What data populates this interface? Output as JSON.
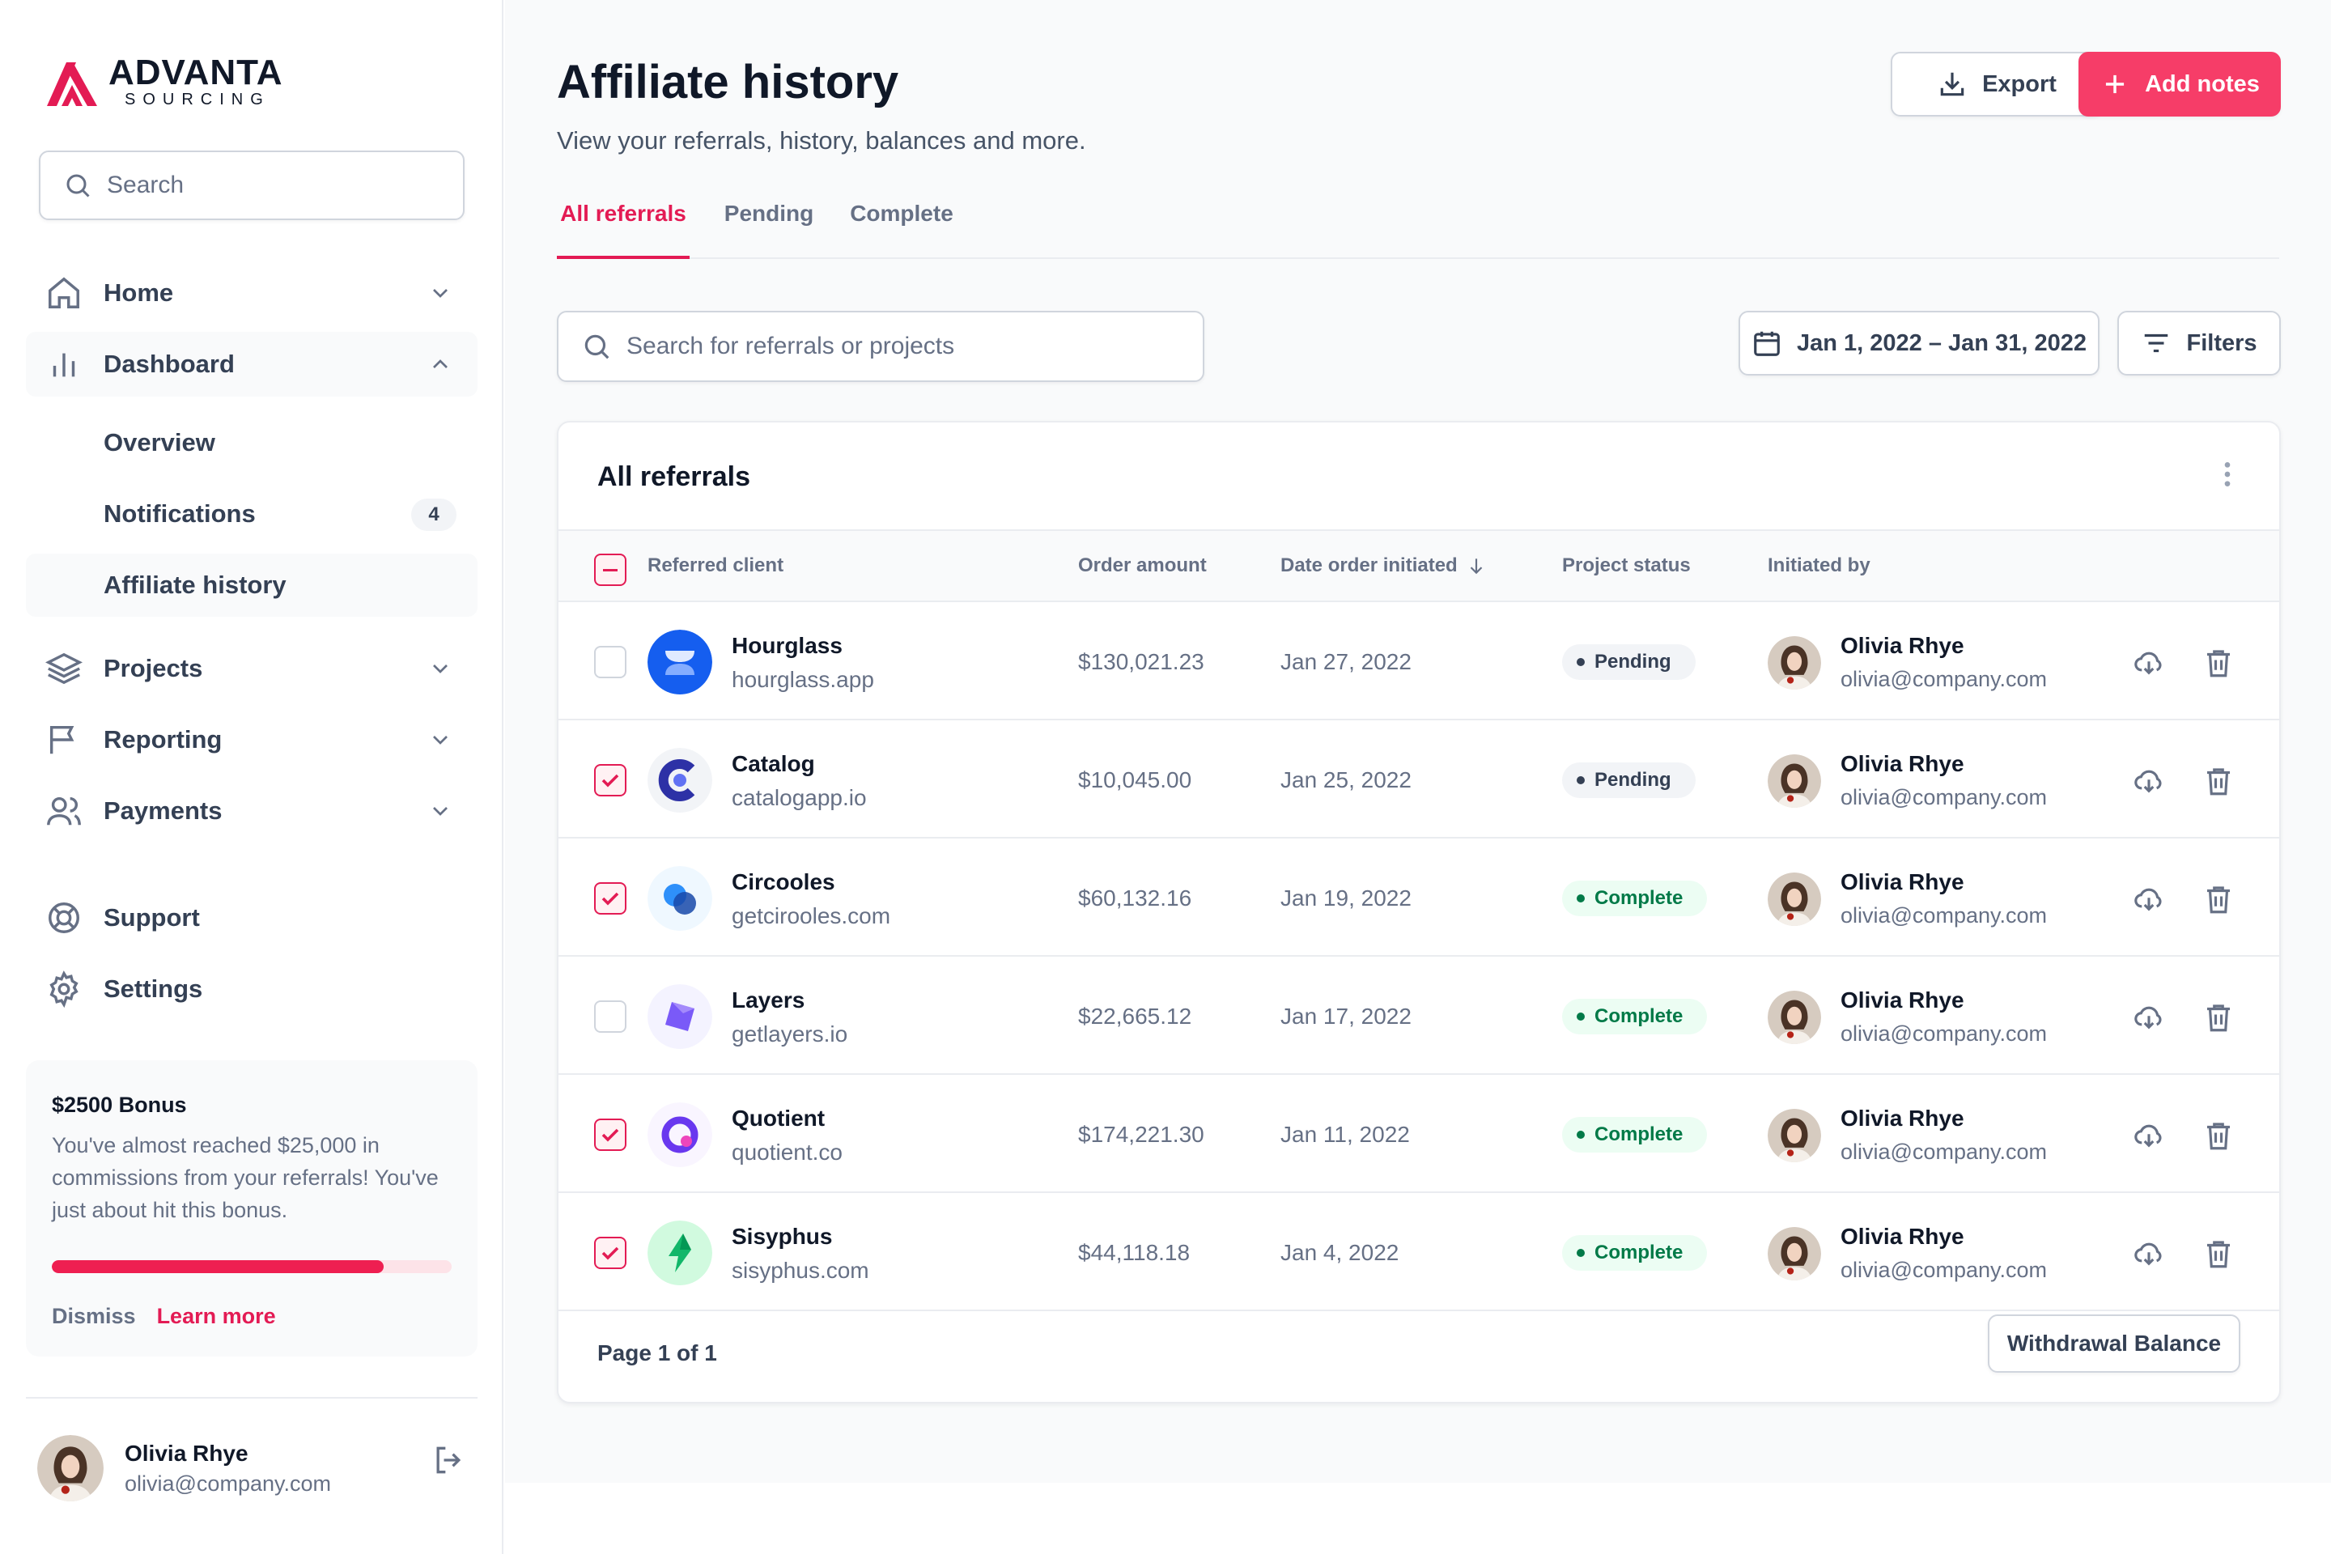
{
  "brand": {
    "name": "ADVANTA",
    "sub": "SOURCING",
    "accent": "#e31b54"
  },
  "sidebar": {
    "search_placeholder": "Search",
    "nav": [
      {
        "label": "Home",
        "icon": "home-icon"
      },
      {
        "label": "Dashboard",
        "icon": "bar-chart-icon"
      },
      {
        "label": "Projects",
        "icon": "layers-icon"
      },
      {
        "label": "Reporting",
        "icon": "flag-icon"
      },
      {
        "label": "Payments",
        "icon": "users-icon"
      },
      {
        "label": "Support",
        "icon": "life-buoy-icon"
      },
      {
        "label": "Settings",
        "icon": "gear-icon"
      }
    ],
    "sub_items": [
      {
        "label": "Overview"
      },
      {
        "label": "Notifications",
        "count": "4"
      },
      {
        "label": "Affiliate history"
      }
    ],
    "bonus": {
      "title": "$2500 Bonus",
      "text": "You've almost reached $25,000 in commissions from your referrals! You've just about hit this bonus.",
      "progress": 0.83,
      "dismiss": "Dismiss",
      "learn_more": "Learn more"
    },
    "user": {
      "name": "Olivia Rhye",
      "email": "olivia@company.com"
    }
  },
  "header": {
    "title": "Affiliate history",
    "subtitle": "View your referrals, history, balances and more.",
    "export_label": "Export",
    "add_label": "Add notes"
  },
  "tabs": [
    {
      "label": "All referrals",
      "active": true
    },
    {
      "label": "Pending",
      "active": false
    },
    {
      "label": "Complete",
      "active": false
    }
  ],
  "toolbar": {
    "search_placeholder": "Search for referrals or projects",
    "date_range": "Jan 1, 2022 – Jan 31, 2022",
    "filters_label": "Filters"
  },
  "table": {
    "title": "All referrals",
    "columns": [
      "Referred client",
      "Order amount",
      "Date order initiated",
      "Project status",
      "Initiated by"
    ],
    "rows": [
      {
        "client": "Hourglass",
        "url": "hourglass.app",
        "amount": "$130,021.23",
        "date": "Jan 27, 2022",
        "status": "Pending",
        "checked": false,
        "by_name": "Olivia Rhye",
        "by_email": "olivia@company.com"
      },
      {
        "client": "Catalog",
        "url": "catalogapp.io",
        "amount": "$10,045.00",
        "date": "Jan 25, 2022",
        "status": "Pending",
        "checked": true,
        "by_name": "Olivia Rhye",
        "by_email": "olivia@company.com"
      },
      {
        "client": "Circooles",
        "url": "getcirooles.com",
        "amount": "$60,132.16",
        "date": "Jan 19, 2022",
        "status": "Complete",
        "checked": true,
        "by_name": "Olivia Rhye",
        "by_email": "olivia@company.com"
      },
      {
        "client": "Layers",
        "url": "getlayers.io",
        "amount": "$22,665.12",
        "date": "Jan 17, 2022",
        "status": "Complete",
        "checked": false,
        "by_name": "Olivia Rhye",
        "by_email": "olivia@company.com"
      },
      {
        "client": "Quotient",
        "url": "quotient.co",
        "amount": "$174,221.30",
        "date": "Jan 11, 2022",
        "status": "Complete",
        "checked": true,
        "by_name": "Olivia Rhye",
        "by_email": "olivia@company.com"
      },
      {
        "client": "Sisyphus",
        "url": "sisyphus.com",
        "amount": "$44,118.18",
        "date": "Jan 4, 2022",
        "status": "Complete",
        "checked": true,
        "by_name": "Olivia Rhye",
        "by_email": "olivia@company.com"
      }
    ],
    "pagination": "Page 1 of 1",
    "withdraw_label": "Withdrawal Balance"
  }
}
